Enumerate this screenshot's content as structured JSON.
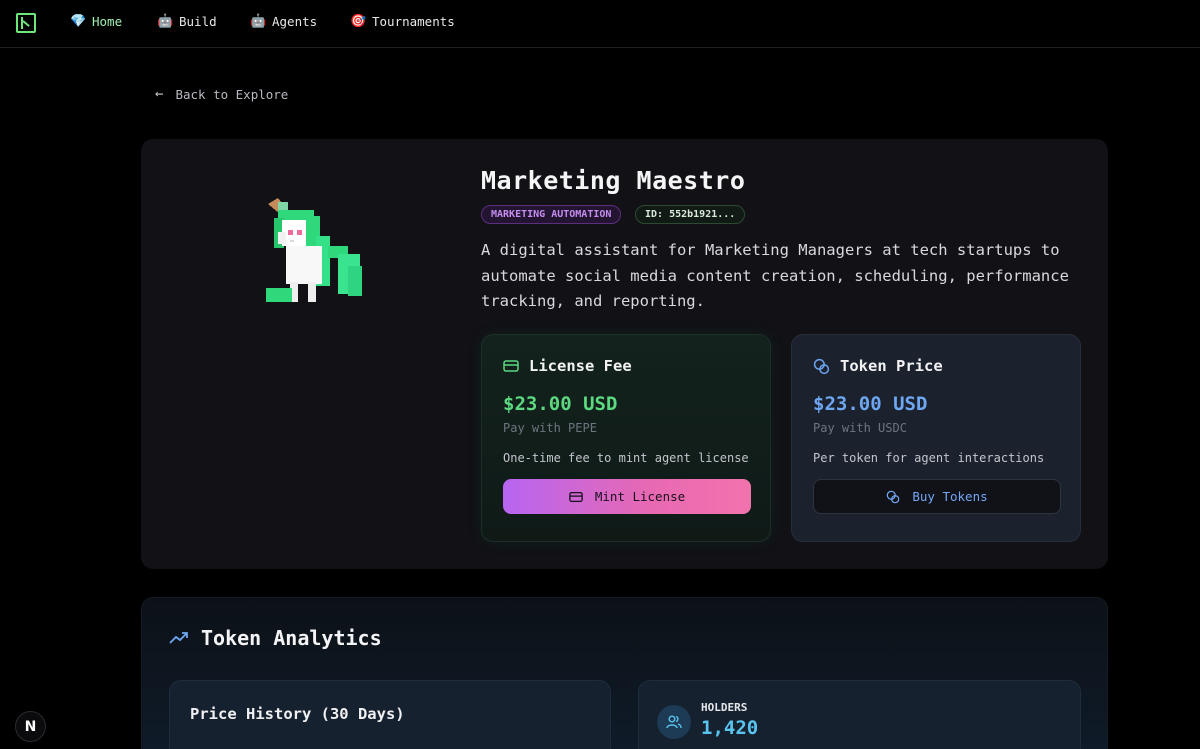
{
  "nav": {
    "items": [
      {
        "label": "Home",
        "icon": "gem-icon",
        "glyph": "💎"
      },
      {
        "label": "Build",
        "icon": "robot-icon",
        "glyph": "🤖"
      },
      {
        "label": "Agents",
        "icon": "robot-icon",
        "glyph": "🤖"
      },
      {
        "label": "Tournaments",
        "icon": "target-icon",
        "glyph": "🎯"
      }
    ]
  },
  "back_label": "Back to Explore",
  "agent": {
    "name": "Marketing Maestro",
    "category": "MARKETING AUTOMATION",
    "id": "ID: 552b1921...",
    "description": "A digital assistant for Marketing Managers at tech startups to automate social media content creation, scheduling, performance tracking, and reporting."
  },
  "license": {
    "title": "License Fee",
    "price": "$23.00 USD",
    "pay": "Pay with PEPE",
    "note": "One-time fee to mint agent license",
    "button": "Mint License"
  },
  "token": {
    "title": "Token Price",
    "price": "$23.00 USD",
    "pay": "Pay with USDC",
    "note": "Per token for agent interactions",
    "button": "Buy Tokens"
  },
  "analytics": {
    "title": "Token Analytics",
    "price_history": {
      "title": "Price History (30 Days)"
    },
    "holders": {
      "label": "HOLDERS",
      "value": "1,420"
    }
  },
  "colors": {
    "accent_green": "#5bd880",
    "accent_blue": "#6ea6f2",
    "accent_pink": "#e869b2"
  }
}
